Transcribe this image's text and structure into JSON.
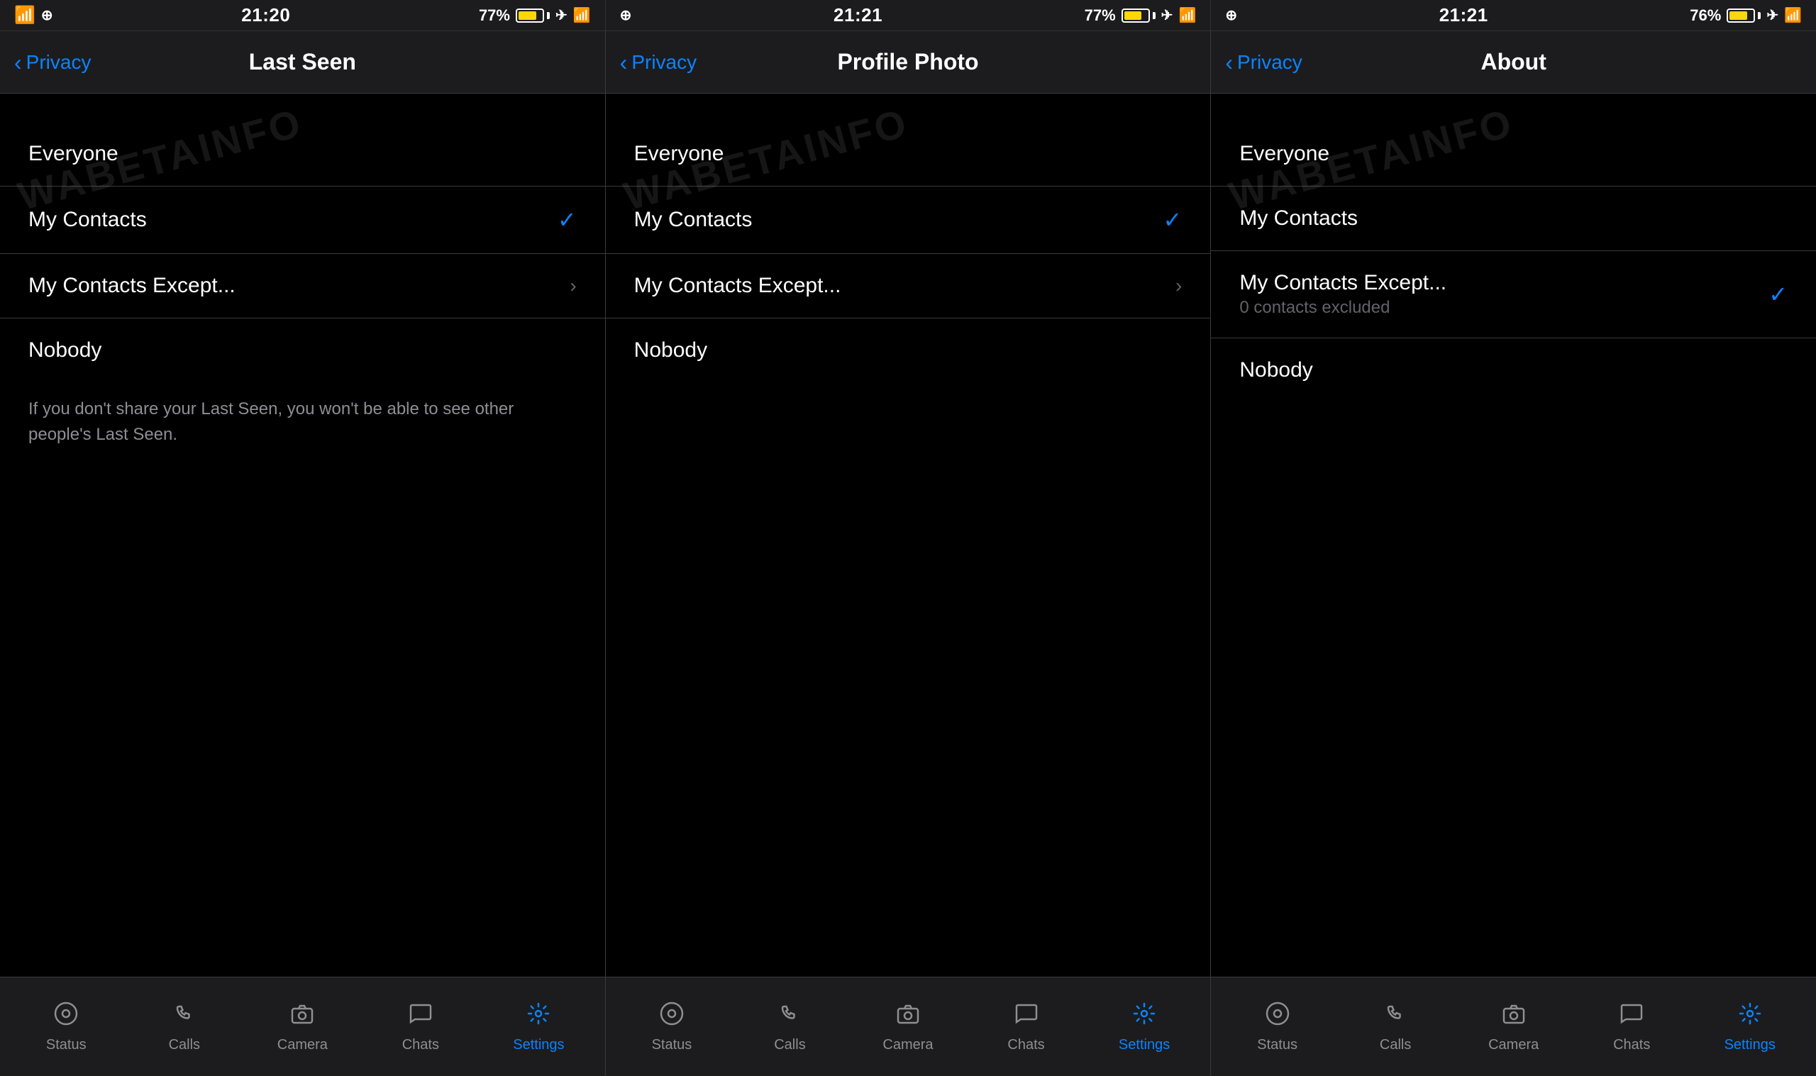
{
  "screens": [
    {
      "id": "last-seen",
      "status": {
        "time": "21:20",
        "battery_level": 77,
        "icons": [
          "wifi",
          "signal"
        ]
      },
      "nav": {
        "back_label": "Privacy",
        "title": "Last Seen"
      },
      "options": [
        {
          "id": "everyone",
          "label": "Everyone",
          "checked": false,
          "has_chevron": false
        },
        {
          "id": "my-contacts",
          "label": "My Contacts",
          "checked": true,
          "has_chevron": false
        },
        {
          "id": "my-contacts-except",
          "label": "My Contacts Except...",
          "checked": false,
          "has_chevron": true
        },
        {
          "id": "nobody",
          "label": "Nobody",
          "checked": false,
          "has_chevron": false
        }
      ],
      "note": "If you don't share your Last Seen, you won't be able to see other people's Last Seen.",
      "tabs": [
        {
          "id": "status",
          "label": "Status",
          "icon": "⊙",
          "active": false
        },
        {
          "id": "calls",
          "label": "Calls",
          "icon": "✆",
          "active": false
        },
        {
          "id": "camera",
          "label": "Camera",
          "icon": "⊡",
          "active": false
        },
        {
          "id": "chats",
          "label": "Chats",
          "icon": "◉",
          "active": false
        },
        {
          "id": "settings",
          "label": "Settings",
          "icon": "⚙",
          "active": true
        }
      ]
    },
    {
      "id": "profile-photo",
      "status": {
        "time": "21:21",
        "battery_level": 77,
        "icons": [
          "wifi",
          "signal"
        ]
      },
      "nav": {
        "back_label": "Privacy",
        "title": "Profile Photo"
      },
      "options": [
        {
          "id": "everyone",
          "label": "Everyone",
          "checked": false,
          "has_chevron": false
        },
        {
          "id": "my-contacts",
          "label": "My Contacts",
          "checked": true,
          "has_chevron": false
        },
        {
          "id": "my-contacts-except",
          "label": "My Contacts Except...",
          "checked": false,
          "has_chevron": true
        },
        {
          "id": "nobody",
          "label": "Nobody",
          "checked": false,
          "has_chevron": false
        }
      ],
      "note": "",
      "tabs": [
        {
          "id": "status",
          "label": "Status",
          "icon": "⊙",
          "active": false
        },
        {
          "id": "calls",
          "label": "Calls",
          "icon": "✆",
          "active": false
        },
        {
          "id": "camera",
          "label": "Camera",
          "icon": "⊡",
          "active": false
        },
        {
          "id": "chats",
          "label": "Chats",
          "icon": "◉",
          "active": false
        },
        {
          "id": "settings",
          "label": "Settings",
          "icon": "⚙",
          "active": true
        }
      ]
    },
    {
      "id": "about",
      "status": {
        "time": "21:21",
        "battery_level": 76,
        "icons": [
          "wifi",
          "signal"
        ]
      },
      "nav": {
        "back_label": "Privacy",
        "title": "About"
      },
      "options": [
        {
          "id": "everyone",
          "label": "Everyone",
          "checked": false,
          "has_chevron": false
        },
        {
          "id": "my-contacts",
          "label": "My Contacts",
          "checked": false,
          "has_chevron": false
        },
        {
          "id": "my-contacts-except",
          "label": "My Contacts Except...",
          "checked": true,
          "has_chevron": false,
          "sublabel": "0 contacts excluded"
        },
        {
          "id": "nobody",
          "label": "Nobody",
          "checked": false,
          "has_chevron": false
        }
      ],
      "note": "",
      "tabs": [
        {
          "id": "status",
          "label": "Status",
          "icon": "⊙",
          "active": false
        },
        {
          "id": "calls",
          "label": "Calls",
          "icon": "✆",
          "active": false
        },
        {
          "id": "camera",
          "label": "Camera",
          "icon": "⊡",
          "active": false
        },
        {
          "id": "chats",
          "label": "Chats",
          "icon": "◉",
          "active": false
        },
        {
          "id": "settings",
          "label": "Settings",
          "icon": "⚙",
          "active": true
        }
      ]
    }
  ],
  "watermark": "WABETAINFO"
}
